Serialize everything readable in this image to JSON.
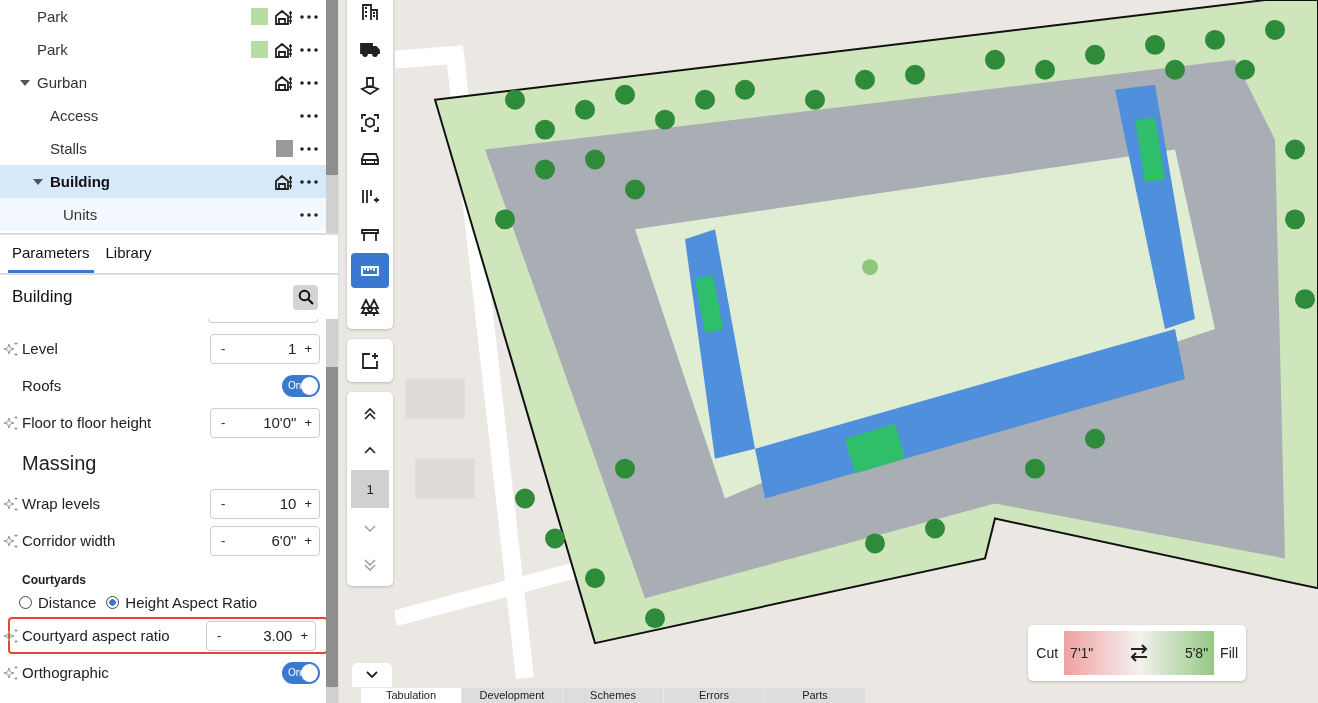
{
  "tree": [
    {
      "label": "Park",
      "color": "#b7dca4",
      "building_icon": true,
      "selected": false
    },
    {
      "label": "Park",
      "color": "#b7dca4",
      "building_icon": true,
      "selected": false
    },
    {
      "label": "Gurban",
      "building_icon": true,
      "selected": false,
      "expanded": true,
      "children": [
        {
          "label": "Access",
          "building_icon": false,
          "selected": false
        },
        {
          "label": "Stalls",
          "color": "#999999",
          "building_icon": false,
          "selected": false
        },
        {
          "label": "Building",
          "building_icon": true,
          "selected": true,
          "expanded": true,
          "children": [
            {
              "label": "Units",
              "building_icon": false,
              "selected": false
            }
          ]
        }
      ]
    }
  ],
  "panel_tabs": [
    {
      "label": "Parameters",
      "selected": true
    },
    {
      "label": "Library",
      "selected": false
    }
  ],
  "section_title": "Building",
  "parameters": [
    {
      "kind": "stepper",
      "label": "Level",
      "value": "1",
      "sparkle": true,
      "highlighted": false
    },
    {
      "kind": "toggle",
      "label": "Roofs",
      "on": true,
      "toggle_label": "On",
      "sparkle": false,
      "highlighted": false
    },
    {
      "kind": "stepper",
      "label": "Floor to floor height",
      "value": "10'0\"",
      "sparkle": true,
      "highlighted": false
    },
    {
      "kind": "heading",
      "label": "Massing"
    },
    {
      "kind": "stepper",
      "label": "Wrap levels",
      "value": "10",
      "sparkle": true,
      "highlighted": false
    },
    {
      "kind": "stepper",
      "label": "Corridor width",
      "value": "6'0\"",
      "sparkle": true,
      "highlighted": false
    },
    {
      "kind": "subheading",
      "label": "Courtyards"
    },
    {
      "kind": "radio",
      "options": [
        {
          "label": "Distance",
          "selected": false
        },
        {
          "label": "Height Aspect Ratio",
          "selected": true
        }
      ]
    },
    {
      "kind": "stepper",
      "label": "Courtyard aspect ratio",
      "value": "3.00",
      "sparkle": true,
      "highlighted": true
    },
    {
      "kind": "toggle",
      "label": "Orthographic",
      "on": true,
      "toggle_label": "On",
      "sparkle": true,
      "highlighted": false
    }
  ],
  "stepper_minus": "-",
  "stepper_plus": "+",
  "toolbar": [
    {
      "selected": false
    },
    {
      "selected": false
    },
    {
      "selected": false
    },
    {
      "selected": false
    },
    {
      "selected": false
    },
    {
      "selected": false
    },
    {
      "selected": false
    },
    {
      "selected": true
    },
    {
      "selected": false
    }
  ],
  "level_nav": {
    "value": "1"
  },
  "legend": {
    "cut_label": "Cut",
    "cut_value": "7'1\"",
    "fill_value": "5'8\"",
    "fill_label": "Fill"
  },
  "bottom_tabs": [
    {
      "label": "Tabulation",
      "selected": true
    },
    {
      "label": "Development",
      "selected": false
    },
    {
      "label": "Schemes",
      "selected": false
    },
    {
      "label": "Errors",
      "selected": false
    },
    {
      "label": "Parts",
      "selected": false
    }
  ]
}
